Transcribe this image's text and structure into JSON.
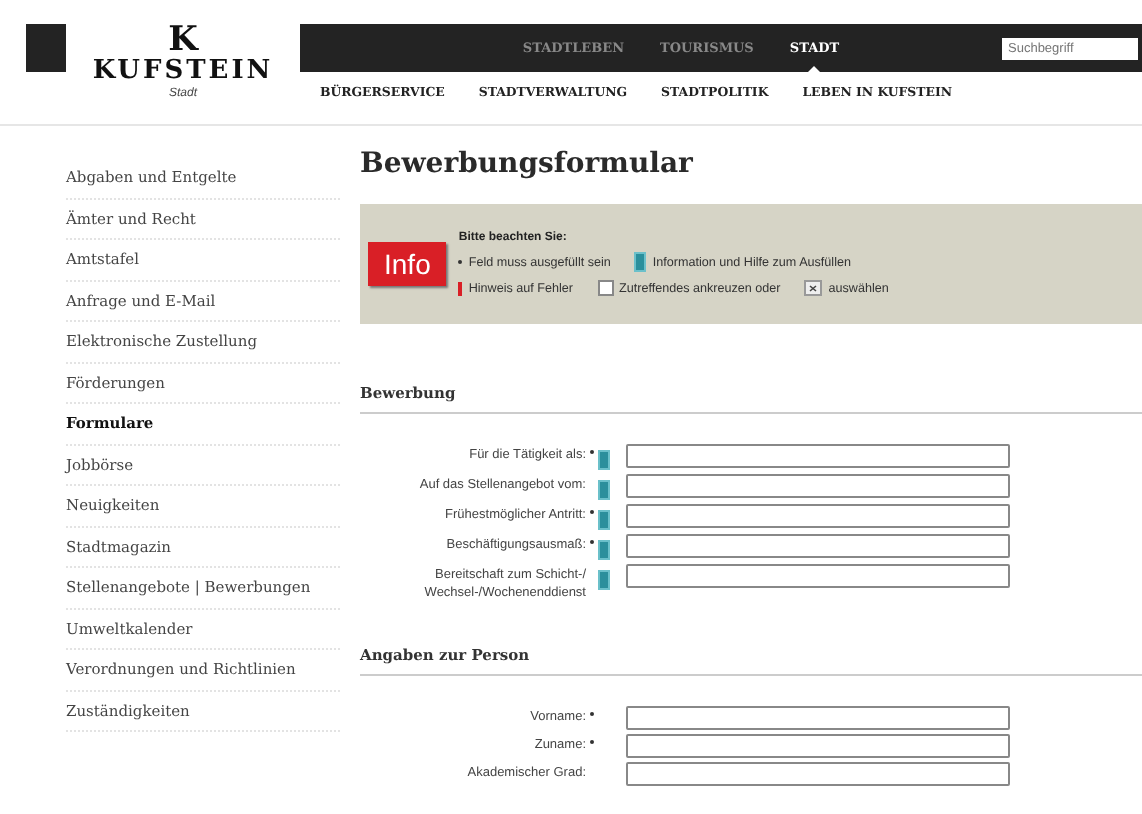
{
  "logo": {
    "letter": "K",
    "name": "KUFSTEIN",
    "subtitle": "Stadt"
  },
  "top_nav": [
    {
      "label": "STADTLEBEN",
      "selected": false
    },
    {
      "label": "TOURISMUS",
      "selected": false
    },
    {
      "label": "STADT",
      "selected": true
    }
  ],
  "search": {
    "placeholder": "Suchbegriff"
  },
  "sub_nav": [
    "BÜRGERSERVICE",
    "STADTVERWALTUNG",
    "STADTPOLITIK",
    "LEBEN IN KUFSTEIN"
  ],
  "sidebar": {
    "items": [
      {
        "label": "Abgaben und Entgelte",
        "selected": false
      },
      {
        "label": "Ämter und Recht",
        "selected": false
      },
      {
        "label": "Amtstafel",
        "selected": false
      },
      {
        "label": "Anfrage und E-Mail",
        "selected": false
      },
      {
        "label": "Elektronische Zustellung",
        "selected": false
      },
      {
        "label": "Förderungen",
        "selected": false
      },
      {
        "label": "Formulare",
        "selected": true
      },
      {
        "label": "Jobbörse",
        "selected": false
      },
      {
        "label": "Neuigkeiten",
        "selected": false
      },
      {
        "label": "Stadtmagazin",
        "selected": false
      },
      {
        "label": "Stellenangebote | Bewerbungen",
        "selected": false
      },
      {
        "label": "Umweltkalender",
        "selected": false
      },
      {
        "label": "Verordnungen und Richtlinien",
        "selected": false
      },
      {
        "label": "Zuständigkeiten",
        "selected": false
      }
    ]
  },
  "page_title": "Bewerbungsformular",
  "info_box": {
    "badge": "Info",
    "heading": "Bitte beachten Sie:",
    "legend_rows": [
      [
        {
          "kind": "required",
          "text": "Feld muss ausgefüllt sein"
        },
        {
          "kind": "info",
          "text": "Information und Hilfe zum Ausfüllen"
        }
      ],
      [
        {
          "kind": "error",
          "text": "Hinweis auf Fehler"
        },
        {
          "kind": "checkbox",
          "text": "Zutreffendes ankreuzen oder"
        },
        {
          "kind": "select",
          "text": "auswählen"
        }
      ]
    ]
  },
  "sections": [
    {
      "title": "Bewerbung",
      "fields": [
        {
          "label": "Für die Tätigkeit als:",
          "required": true,
          "info": true
        },
        {
          "label": "Auf das Stellenangebot vom:",
          "required": false,
          "info": true
        },
        {
          "label": "Frühestmöglicher Antritt:",
          "required": true,
          "info": true
        },
        {
          "label": "Beschäftigungsausmaß:",
          "required": true,
          "info": true
        },
        {
          "label": "Bereitschaft zum Schicht-/ Wechsel-/Wochenenddienst",
          "required": false,
          "info": true
        }
      ]
    },
    {
      "title": "Angaben zur Person",
      "fields": [
        {
          "label": "Vorname:",
          "required": true,
          "info": false
        },
        {
          "label": "Zuname:",
          "required": true,
          "info": false
        },
        {
          "label": "Akademischer Grad:",
          "required": false,
          "info": false
        }
      ]
    }
  ]
}
